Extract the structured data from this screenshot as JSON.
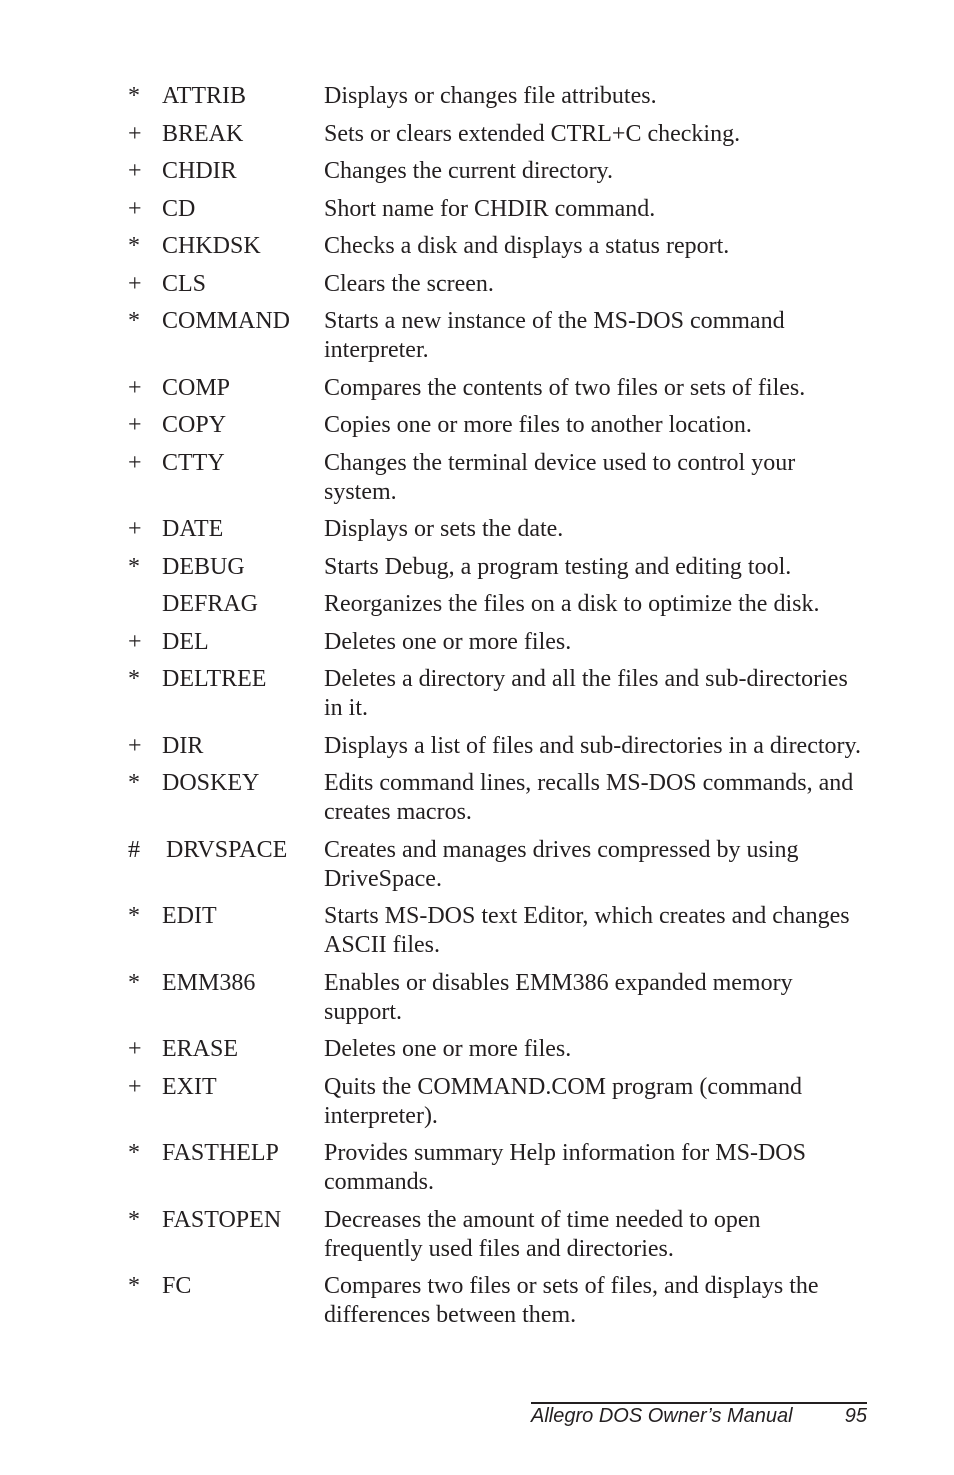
{
  "entries": [
    {
      "mark": "*",
      "command": "ATTRIB",
      "description": "Displays or changes file attributes."
    },
    {
      "mark": "+",
      "command": "BREAK",
      "description": "Sets or clears extended CTRL+C checking."
    },
    {
      "mark": "+",
      "command": "CHDIR",
      "description": "Changes the current directory."
    },
    {
      "mark": "+",
      "command": "CD",
      "description": "Short name for CHDIR command."
    },
    {
      "mark": "*",
      "command": "CHKDSK",
      "description": "Checks a disk and displays a status report."
    },
    {
      "mark": "+",
      "command": "CLS",
      "description": "Clears the screen."
    },
    {
      "mark": "*",
      "command": "COMMAND",
      "description": "Starts a new instance of the MS-DOS command interpreter."
    },
    {
      "mark": "+",
      "command": "COMP",
      "description": "Compares the contents of two files or sets of files."
    },
    {
      "mark": "+",
      "command": "COPY",
      "description": "Copies one or more files to another location."
    },
    {
      "mark": "+",
      "command": "CTTY",
      "description": "Changes the terminal device used to control your system."
    },
    {
      "mark": "+",
      "command": "DATE",
      "description": "Displays or sets the date."
    },
    {
      "mark": "*",
      "command": "DEBUG",
      "description": "Starts Debug, a program testing and editing tool."
    },
    {
      "mark": "",
      "command": "DEFRAG",
      "description": "Reorganizes the files on a disk to optimize the disk."
    },
    {
      "mark": "+",
      "command": "DEL",
      "description": "Deletes one or more files."
    },
    {
      "mark": "*",
      "command": "DELTREE",
      "description": "Deletes a directory and all the files and sub-directories in it."
    },
    {
      "mark": "+",
      "command": "DIR",
      "description": "Displays a list of files and sub-directories in a directory."
    },
    {
      "mark": "*",
      "command": "DOSKEY",
      "description": "Edits command lines, recalls MS-DOS commands, and creates macros."
    },
    {
      "mark": "#",
      "command": "DRVSPACE",
      "description": "Creates and manages drives compressed by using DriveSpace."
    },
    {
      "mark": "*",
      "command": "EDIT",
      "description": "Starts MS-DOS text Editor, which creates and changes ASCII files."
    },
    {
      "mark": "*",
      "command": "EMM386",
      "description": "Enables or disables EMM386 expanded memory support."
    },
    {
      "mark": "+",
      "command": "ERASE",
      "description": "Deletes one or more files."
    },
    {
      "mark": "+",
      "command": "EXIT",
      "description": "Quits the COMMAND.COM program (command interpreter)."
    },
    {
      "mark": "*",
      "command": "FASTHELP",
      "description": "Provides summary Help information for MS-DOS commands."
    },
    {
      "mark": "*",
      "command": "FASTOPEN",
      "description": "Decreases the amount of time needed to open frequently used files and directories."
    },
    {
      "mark": "*",
      "command": "FC",
      "description": "Compares two files or sets of files, and displays the differences between them."
    }
  ],
  "footer": {
    "title": "Allegro DOS Owner’s Manual",
    "page": "95"
  }
}
